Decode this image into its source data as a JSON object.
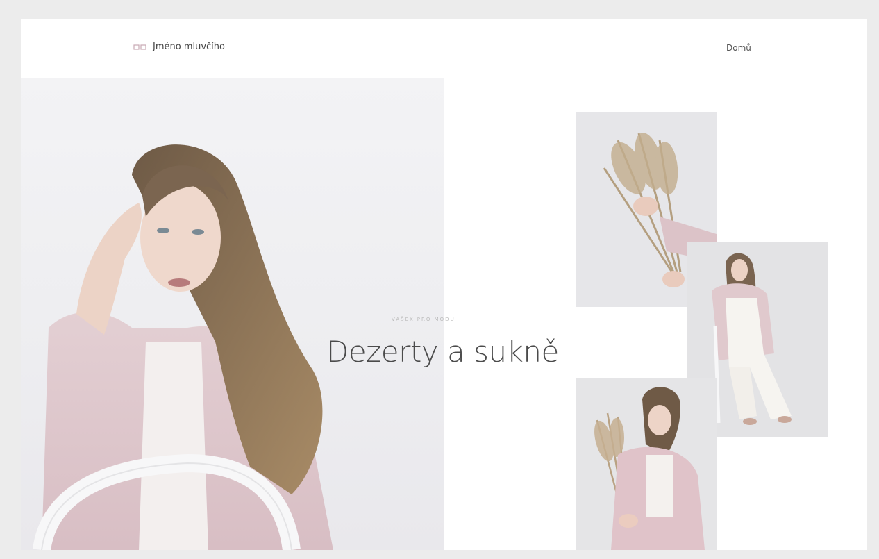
{
  "header": {
    "brand_name": "Jméno mluvčího",
    "nav_link": "Domů"
  },
  "hero": {
    "eyebrow": "VAŠEK PRO MODU",
    "headline": "Dezerty a sukně"
  },
  "images": {
    "hero": "woman-seated-portrait",
    "photo_1": "hand-holding-dried-grass",
    "photo_2": "woman-seated-white-outfit",
    "photo_3": "woman-with-dried-flowers"
  },
  "colors": {
    "accent": "#c9a9b3",
    "text": "#4b4b4b",
    "muted": "#bbbbbb"
  }
}
